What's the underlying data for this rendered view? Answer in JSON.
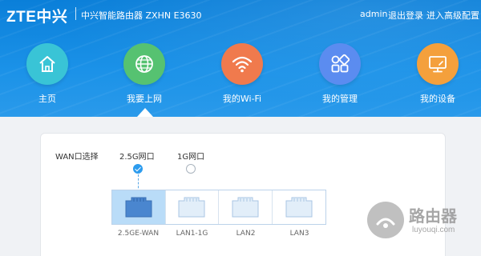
{
  "header": {
    "logo": "ZTE中兴",
    "product": "中兴智能路由器 ZXHN E3630",
    "user": "admin",
    "logout": "退出登录",
    "advanced": "进入高级配置"
  },
  "nav": {
    "items": [
      {
        "label": "主页",
        "icon": "home-icon",
        "color": "#39c4d6"
      },
      {
        "label": "我要上网",
        "icon": "globe-icon",
        "color": "#56c271",
        "selected": true
      },
      {
        "label": "我的Wi-Fi",
        "icon": "wifi-icon",
        "color": "#f07a4d"
      },
      {
        "label": "我的管理",
        "icon": "grid-icon",
        "color": "#5b8cf0"
      },
      {
        "label": "我的设备",
        "icon": "monitor-icon",
        "color": "#f4a03c"
      }
    ]
  },
  "wan": {
    "label": "WAN口选择",
    "options": [
      {
        "label": "2.5G网口",
        "checked": true
      },
      {
        "label": "1G网口",
        "checked": false
      }
    ],
    "ports": [
      {
        "label": "2.5GE-WAN",
        "active": true
      },
      {
        "label": "LAN1-1G",
        "active": false
      },
      {
        "label": "LAN2",
        "active": false
      },
      {
        "label": "LAN3",
        "active": false
      }
    ]
  },
  "watermark": {
    "text": "路由器",
    "sub": "luyouqi.com"
  }
}
